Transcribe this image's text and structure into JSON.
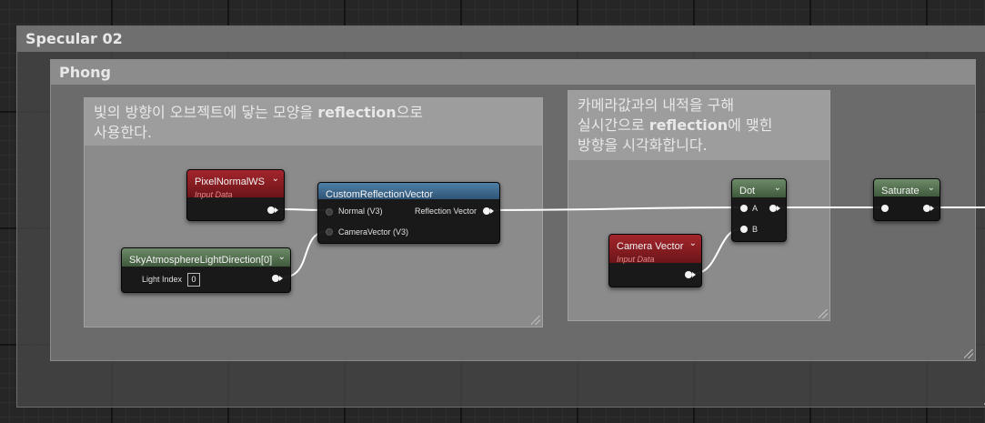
{
  "comments": {
    "specular_title": "Specular 02",
    "phong_title": "Phong",
    "reflection_note": {
      "line1_pre": "빛의 방향이 오브젝트에 닿는 모양을 ",
      "line1_bold": "reflection",
      "line1_post": "으로",
      "line2": "사용한다."
    },
    "camera_note": {
      "line1": "카메라값과의 내적을 구해",
      "line2_pre": "실시간으로 ",
      "line2_bold": "reflection",
      "line2_post": "에 맺힌",
      "line3": "방향을 시각화합니다."
    }
  },
  "nodes": {
    "pixel_normal": {
      "title": "PixelNormalWS",
      "subtitle": "Input Data"
    },
    "sky_light": {
      "title": "SkyAtmosphereLightDirection[0]",
      "light_index_label": "Light Index",
      "light_index_value": "0"
    },
    "custom_reflection": {
      "title": "CustomReflectionVector",
      "input_normal": "Normal (V3)",
      "input_camera": "CameraVector (V3)",
      "output": "Reflection Vector"
    },
    "camera_vector": {
      "title": "Camera Vector",
      "subtitle": "Input Data"
    },
    "dot": {
      "title": "Dot",
      "input_a": "A",
      "input_b": "B"
    },
    "saturate": {
      "title": "Saturate"
    }
  },
  "colors": {
    "input_header": "#a3252c",
    "math_header": "#6d8a68",
    "function_header": "#4f7fa6",
    "wire": "#ffffff"
  },
  "icons": {
    "collapse": "chevron-down-icon",
    "resize": "resize-grip-icon"
  }
}
